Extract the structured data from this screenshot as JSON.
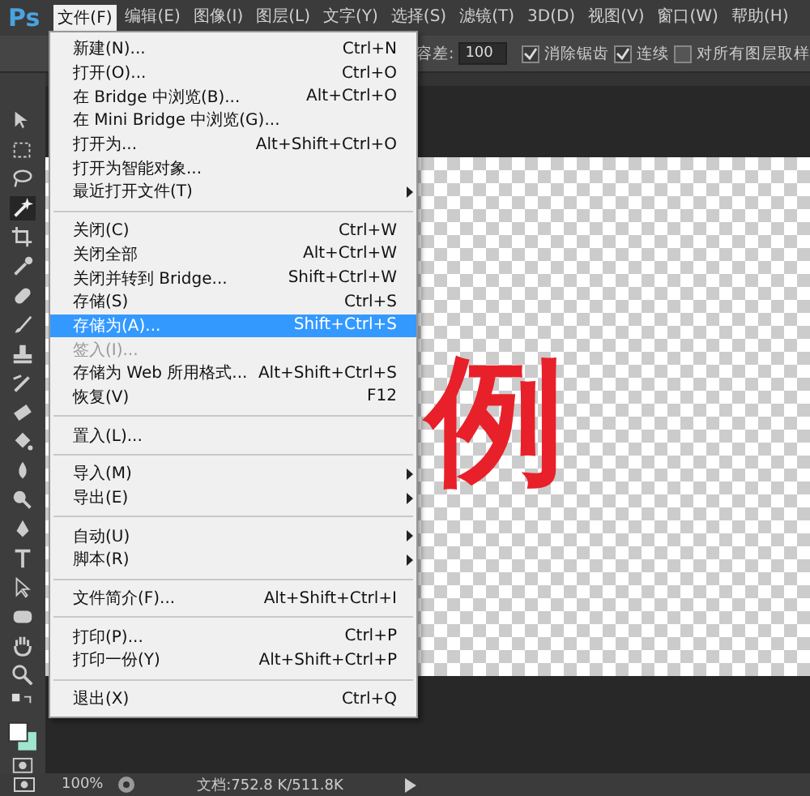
{
  "app": {
    "logo": "Ps"
  },
  "menubar": [
    {
      "label": "文件(F)",
      "selected": true
    },
    {
      "label": "编辑(E)",
      "selected": false
    },
    {
      "label": "图像(I)",
      "selected": false
    },
    {
      "label": "图层(L)",
      "selected": false
    },
    {
      "label": "文字(Y)",
      "selected": false
    },
    {
      "label": "选择(S)",
      "selected": false
    },
    {
      "label": "滤镜(T)",
      "selected": false
    },
    {
      "label": "3D(D)",
      "selected": false
    },
    {
      "label": "视图(V)",
      "selected": false
    },
    {
      "label": "窗口(W)",
      "selected": false
    },
    {
      "label": "帮助(H)",
      "selected": false
    }
  ],
  "options_bar": {
    "tolerance_label": "容差:",
    "tolerance_value": "100",
    "checkboxes": [
      {
        "label": "消除锯齿",
        "checked": true
      },
      {
        "label": "连续",
        "checked": true
      },
      {
        "label": "对所有图层取样",
        "checked": false
      }
    ]
  },
  "file_menu": [
    {
      "kind": "item",
      "label": "新建(N)...",
      "shortcut": "Ctrl+N",
      "submenu": false,
      "selected": false,
      "disabled": false
    },
    {
      "kind": "item",
      "label": "打开(O)...",
      "shortcut": "Ctrl+O",
      "submenu": false,
      "selected": false,
      "disabled": false
    },
    {
      "kind": "item",
      "label": "在 Bridge 中浏览(B)...",
      "shortcut": "Alt+Ctrl+O",
      "submenu": false,
      "selected": false,
      "disabled": false
    },
    {
      "kind": "item",
      "label": "在 Mini Bridge 中浏览(G)...",
      "submenu": false,
      "selected": false,
      "disabled": false
    },
    {
      "kind": "item",
      "label": "打开为...",
      "shortcut": "Alt+Shift+Ctrl+O",
      "submenu": false,
      "selected": false,
      "disabled": false
    },
    {
      "kind": "item",
      "label": "打开为智能对象...",
      "submenu": false,
      "selected": false,
      "disabled": false
    },
    {
      "kind": "item",
      "label": "最近打开文件(T)",
      "submenu": true,
      "selected": false,
      "disabled": false
    },
    {
      "kind": "separator"
    },
    {
      "kind": "item",
      "label": "关闭(C)",
      "shortcut": "Ctrl+W",
      "submenu": false,
      "selected": false,
      "disabled": false
    },
    {
      "kind": "item",
      "label": "关闭全部",
      "shortcut": "Alt+Ctrl+W",
      "submenu": false,
      "selected": false,
      "disabled": false
    },
    {
      "kind": "item",
      "label": "关闭并转到 Bridge...",
      "shortcut": "Shift+Ctrl+W",
      "submenu": false,
      "selected": false,
      "disabled": false
    },
    {
      "kind": "item",
      "label": "存储(S)",
      "shortcut": "Ctrl+S",
      "submenu": false,
      "selected": false,
      "disabled": false
    },
    {
      "kind": "item",
      "label": "存储为(A)...",
      "shortcut": "Shift+Ctrl+S",
      "submenu": false,
      "selected": true,
      "disabled": false
    },
    {
      "kind": "item",
      "label": "签入(I)...",
      "submenu": false,
      "selected": false,
      "disabled": true
    },
    {
      "kind": "item",
      "label": "存储为 Web 所用格式...",
      "shortcut": "Alt+Shift+Ctrl+S",
      "submenu": false,
      "selected": false,
      "disabled": false
    },
    {
      "kind": "item",
      "label": "恢复(V)",
      "shortcut": "F12",
      "submenu": false,
      "selected": false,
      "disabled": false
    },
    {
      "kind": "separator"
    },
    {
      "kind": "item",
      "label": "置入(L)...",
      "submenu": false,
      "selected": false,
      "disabled": false
    },
    {
      "kind": "separator"
    },
    {
      "kind": "item",
      "label": "导入(M)",
      "submenu": true,
      "selected": false,
      "disabled": false
    },
    {
      "kind": "item",
      "label": "导出(E)",
      "submenu": true,
      "selected": false,
      "disabled": false
    },
    {
      "kind": "separator"
    },
    {
      "kind": "item",
      "label": "自动(U)",
      "submenu": true,
      "selected": false,
      "disabled": false
    },
    {
      "kind": "item",
      "label": "脚本(R)",
      "submenu": true,
      "selected": false,
      "disabled": false
    },
    {
      "kind": "separator"
    },
    {
      "kind": "item",
      "label": "文件简介(F)...",
      "shortcut": "Alt+Shift+Ctrl+I",
      "submenu": false,
      "selected": false,
      "disabled": false
    },
    {
      "kind": "separator"
    },
    {
      "kind": "item",
      "label": "打印(P)...",
      "shortcut": "Ctrl+P",
      "submenu": false,
      "selected": false,
      "disabled": false
    },
    {
      "kind": "item",
      "label": "打印一份(Y)",
      "shortcut": "Alt+Shift+Ctrl+P",
      "submenu": false,
      "selected": false,
      "disabled": false
    },
    {
      "kind": "separator"
    },
    {
      "kind": "item",
      "label": "退出(X)",
      "shortcut": "Ctrl+Q",
      "submenu": false,
      "selected": false,
      "disabled": false
    }
  ],
  "canvas": {
    "text": "例"
  },
  "status_bar": {
    "zoom": "100%",
    "document": "文档:752.8 K/511.8K"
  }
}
